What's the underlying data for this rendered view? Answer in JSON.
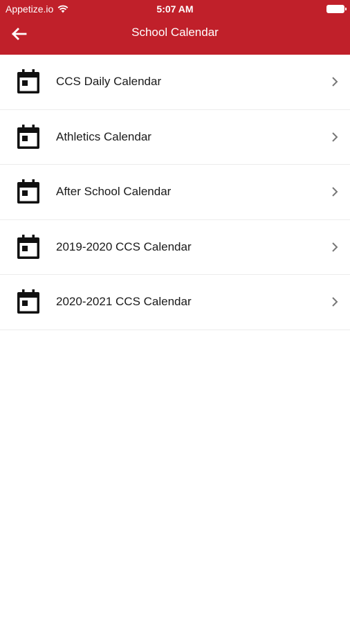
{
  "status_bar": {
    "carrier": "Appetize.io",
    "time": "5:07 AM"
  },
  "nav": {
    "title": "School Calendar"
  },
  "calendars": [
    {
      "label": "CCS Daily Calendar"
    },
    {
      "label": "Athletics Calendar"
    },
    {
      "label": "After School Calendar"
    },
    {
      "label": "2019-2020 CCS Calendar"
    },
    {
      "label": "2020-2021 CCS Calendar"
    }
  ],
  "colors": {
    "header": "#c0202a",
    "divider": "#ececec"
  },
  "icons": {
    "back": "arrow-left-icon",
    "calendar": "calendar-icon",
    "chevron": "chevron-right-icon",
    "wifi": "wifi-icon",
    "battery": "battery-icon"
  }
}
